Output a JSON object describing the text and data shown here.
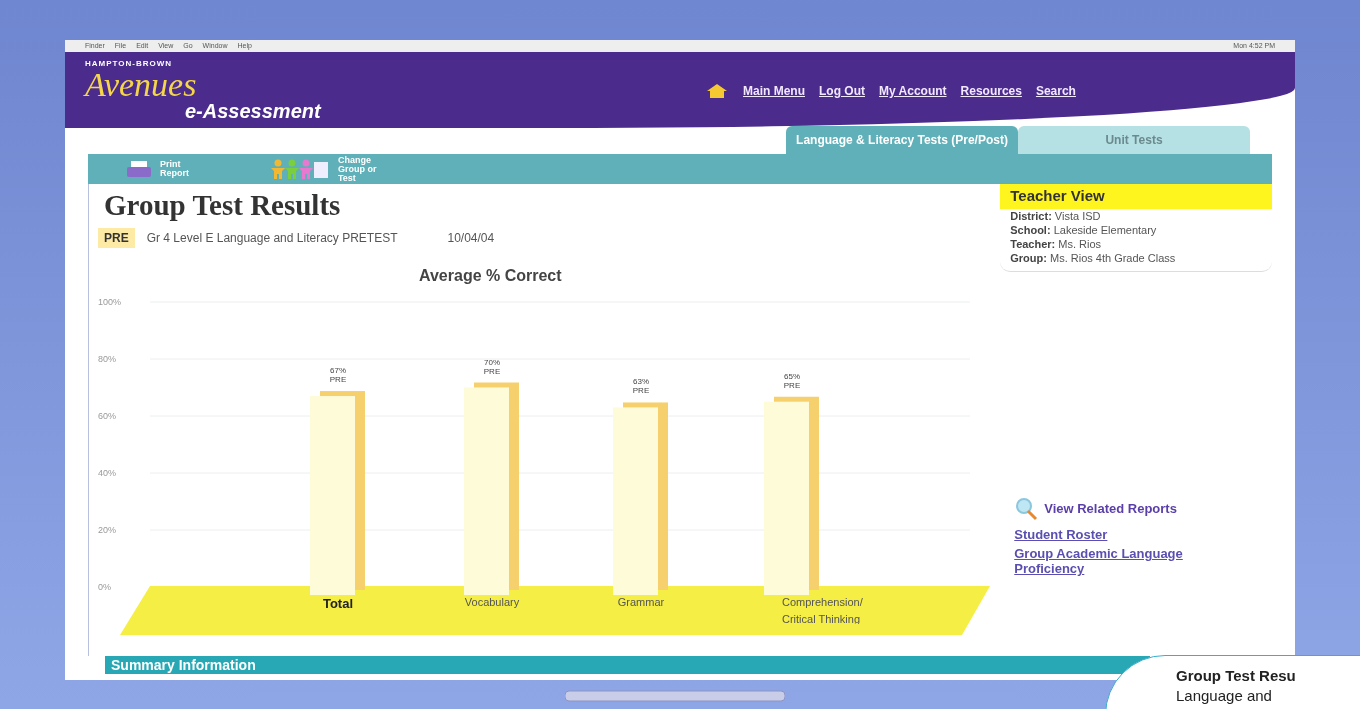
{
  "menu_bar": {
    "items": [
      "Finder",
      "File",
      "Edit",
      "View",
      "Go",
      "Window",
      "Help"
    ],
    "clock": "Mon 4:52 PM"
  },
  "header": {
    "publisher": "HAMPTON-BROWN",
    "logo": "Avenues",
    "product": "e-Assessment",
    "nav": [
      "Main Menu",
      "Log Out",
      "My Account",
      "Resources",
      "Search"
    ]
  },
  "tabs": [
    {
      "label": "Language & Literacy Tests (Pre/Post)",
      "selected": true
    },
    {
      "label": "Unit Tests",
      "selected": false
    }
  ],
  "toolbar": [
    {
      "kind": "print",
      "label": "Print Report"
    },
    {
      "kind": "group",
      "label": "Change Group or Test"
    }
  ],
  "page_title": "Group Test Results",
  "test": {
    "badge": "PRE",
    "name": "Gr 4 Level E Language and Literacy PRETEST",
    "date": "10/04/04"
  },
  "chart_data": {
    "type": "bar",
    "title": "Average % Correct",
    "categories": [
      "Total",
      "Vocabulary",
      "Grammar",
      "Comprehension/ Critical Thinking"
    ],
    "values": [
      67,
      70,
      63,
      65
    ],
    "ylim": [
      0,
      100
    ],
    "grid": true,
    "yticks": [
      {
        "value": 0,
        "label": "0%"
      },
      {
        "value": 20,
        "label": "20%"
      },
      {
        "value": 40,
        "label": "40%"
      },
      {
        "value": 60,
        "label": "60%"
      },
      {
        "value": 80,
        "label": "80%"
      },
      {
        "value": 100,
        "label": "100%"
      }
    ],
    "value_labels": [
      "67% PRE",
      "70% PRE",
      "63% PRE",
      "65% PRE"
    ]
  },
  "teacher_view": {
    "title": "Teacher View",
    "fields": [
      {
        "label": "District:",
        "value": "Vista ISD"
      },
      {
        "label": "School:",
        "value": "Lakeside Elementary"
      },
      {
        "label": "Teacher:",
        "value": "Ms. Rios"
      },
      {
        "label": "Group:",
        "value": "Ms. Rios 4th Grade Class"
      }
    ]
  },
  "related": {
    "title": "View Related Reports",
    "links": [
      "Student Roster",
      "Group Academic Language Proficiency"
    ]
  },
  "summary": {
    "title": "Summary Information"
  },
  "callout": {
    "lines": [
      "Group Test Resu",
      "Language and"
    ]
  }
}
